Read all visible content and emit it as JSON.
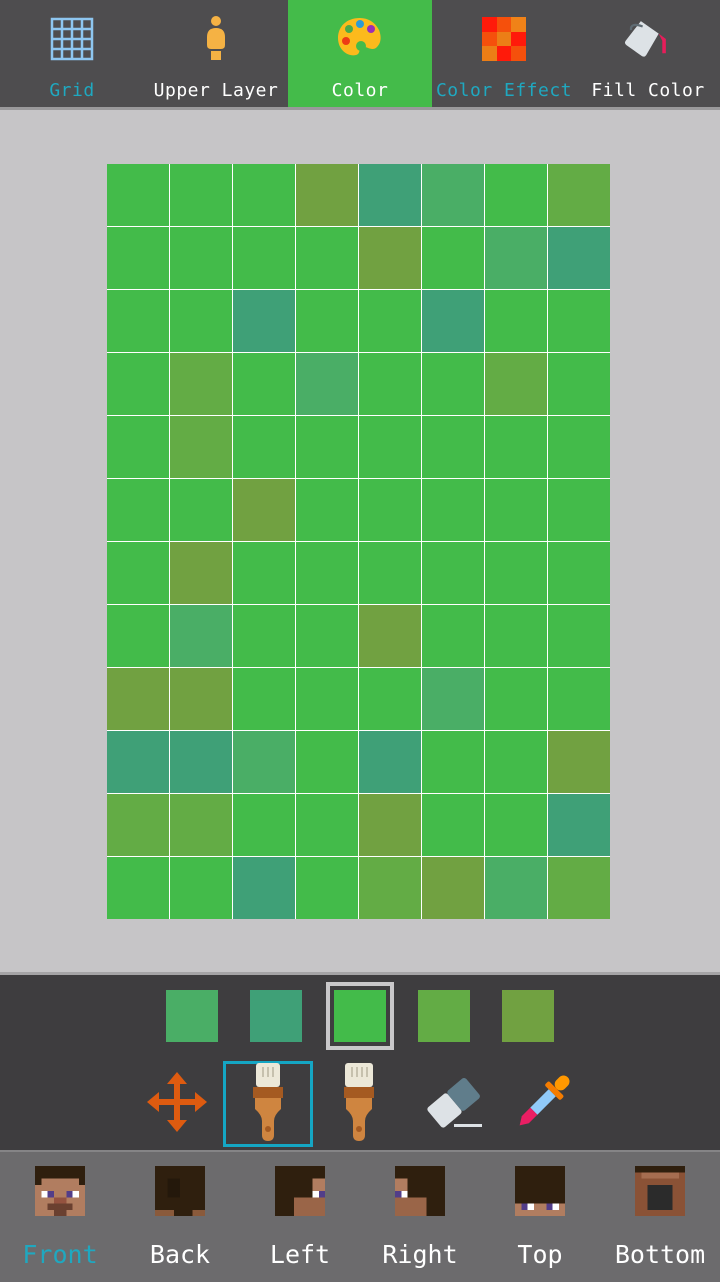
{
  "toolbar": {
    "tabs": [
      {
        "label": "Grid",
        "icon": "grid-icon",
        "highlighted_text": true,
        "active": false
      },
      {
        "label": "Upper Layer",
        "icon": "person-layer-icon",
        "highlighted_text": false,
        "active": false
      },
      {
        "label": "Color",
        "icon": "palette-icon",
        "highlighted_text": false,
        "active": true
      },
      {
        "label": "Color Effect",
        "icon": "checker-effect-icon",
        "highlighted_text": true,
        "active": false
      },
      {
        "label": "Fill Color",
        "icon": "paint-bucket-icon",
        "highlighted_text": false,
        "active": false
      }
    ],
    "active_color": "#44bb4a",
    "highlight_text_color": "#1fa8c0"
  },
  "canvas": {
    "columns": 8,
    "rows": 12,
    "palette": {
      "G": "#43bb4a",
      "T": "#3fa077",
      "M": "#4aae66",
      "O": "#71a141",
      "L": "#63ac45"
    },
    "cells": [
      "GGGOTMGL",
      "GGGGOGMT",
      "GGTGGTGG",
      "GLGMGGLG",
      "GLGGGGGG",
      "GGOGGGGG",
      "GOGGGGGG",
      "GMGGOGGG",
      "OOGGGMGG",
      "TTMGTGGO",
      "LLGGOGGT",
      "GGTGLOML"
    ]
  },
  "swatches": [
    {
      "color": "#4aae66",
      "selected": false
    },
    {
      "color": "#3fa077",
      "selected": false
    },
    {
      "color": "#43bb4a",
      "selected": true
    },
    {
      "color": "#63ac45",
      "selected": false
    },
    {
      "color": "#71a141",
      "selected": false
    }
  ],
  "tools": [
    {
      "name": "move",
      "icon": "move-arrows-icon",
      "selected": false
    },
    {
      "name": "brush",
      "icon": "paintbrush-icon",
      "selected": true
    },
    {
      "name": "noise-brush",
      "icon": "paintbrush-icon",
      "selected": false
    },
    {
      "name": "eraser",
      "icon": "eraser-icon",
      "selected": false
    },
    {
      "name": "eyedropper",
      "icon": "eyedropper-icon",
      "selected": false
    }
  ],
  "faces": [
    {
      "label": "Front",
      "active": true
    },
    {
      "label": "Back",
      "active": false
    },
    {
      "label": "Left",
      "active": false
    },
    {
      "label": "Right",
      "active": false
    },
    {
      "label": "Top",
      "active": false
    },
    {
      "label": "Bottom",
      "active": false
    }
  ]
}
